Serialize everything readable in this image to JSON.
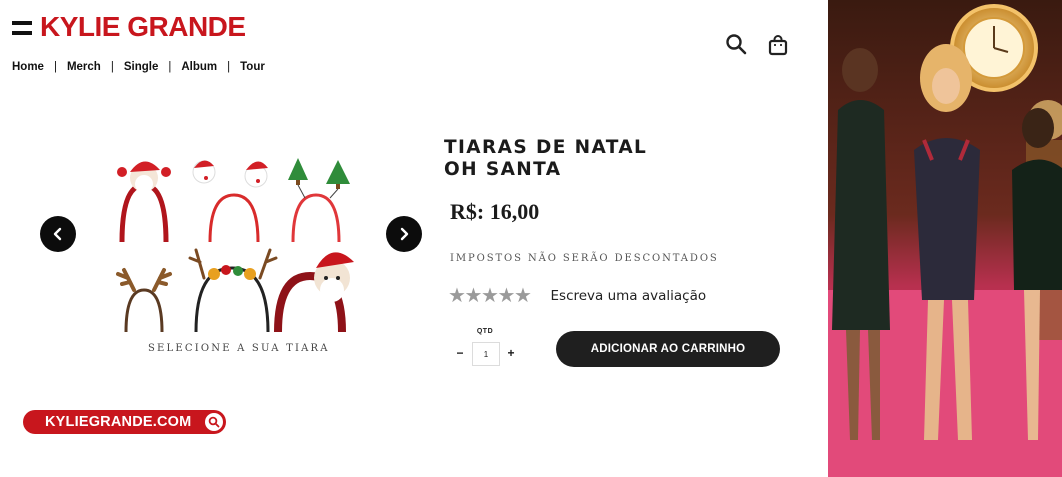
{
  "header": {
    "logo": "KYLIE GRANDE",
    "nav": [
      "Home",
      "Merch",
      "Single",
      "Album",
      "Tour"
    ],
    "separator": "|",
    "icons": {
      "search": "search-icon",
      "bag": "shopping-bag-icon",
      "menu": "hamburger-menu-icon"
    }
  },
  "gallery": {
    "caption": "SELECIONE A SUA TIARA",
    "prev_icon": "chevron-left-icon",
    "next_icon": "chevron-right-icon"
  },
  "product": {
    "title_line1": "TIARAS DE NATAL",
    "title_line2": "OH SANTA",
    "price": "R$: 16,00",
    "tax_note": "IMPOSTOS NÃO SERÃO DESCONTADOS",
    "rating_stars": 5,
    "review_link": "Escreva uma avaliação",
    "qty_label": "QTD",
    "qty_value": "1",
    "qty_minus": "−",
    "qty_plus": "+",
    "add_to_cart": "ADICIONAR AO CARRINHO"
  },
  "footer": {
    "site_link": "KYLIEGRANDE.COM"
  },
  "colors": {
    "brand_red": "#c8161d",
    "button_dark": "#1f1f1f",
    "star_grey": "#9a9a9a",
    "stage_pink": "#e0356b"
  }
}
